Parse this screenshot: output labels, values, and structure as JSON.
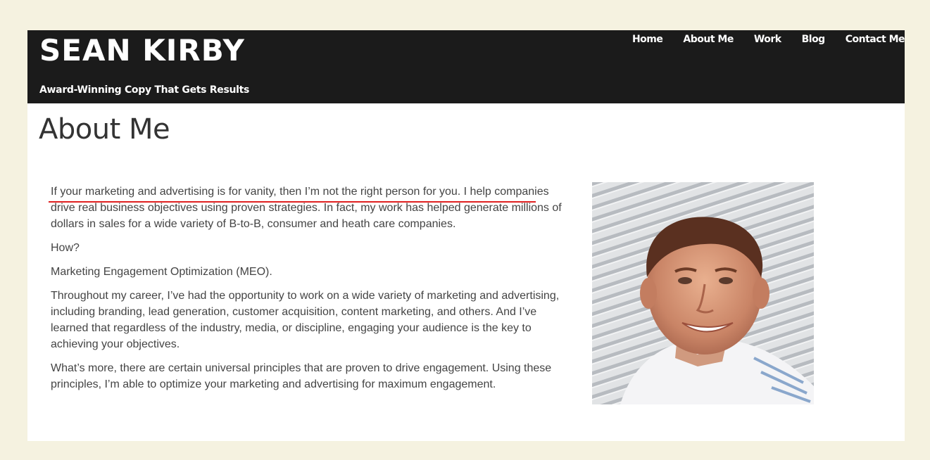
{
  "site": {
    "title": "SEAN KIRBY",
    "tagline": "Award-Winning Copy That Gets Results"
  },
  "nav": [
    {
      "label": "Home"
    },
    {
      "label": "About Me"
    },
    {
      "label": "Work"
    },
    {
      "label": "Blog"
    },
    {
      "label": "Contact Me"
    }
  ],
  "page": {
    "heading": "About Me",
    "paragraphs": [
      "If your marketing and advertising is for vanity, then I’m not the right person for you. I help companies drive real business objectives using proven strategies. In fact, my work has helped generate millions of dollars in sales for a wide variety of B-to-B, consumer and heath care companies.",
      "How?",
      "Marketing Engagement Optimization (MEO).",
      "Throughout my career, I’ve had the opportunity to work on a wide variety of marketing and advertising, including branding, lead generation, customer acquisition, content marketing, and others. And I’ve learned that regardless of the industry, media, or discipline, engaging your audience is the key to achieving your objectives.",
      "What’s more, there are certain universal principles that are proven to drive engagement. Using these principles, I’m able to optimize your marketing and advertising for maximum engagement."
    ]
  },
  "colors": {
    "page_background": "#f5f2e0",
    "header_background": "#1b1b1b",
    "annotation_underline": "#e02020"
  }
}
